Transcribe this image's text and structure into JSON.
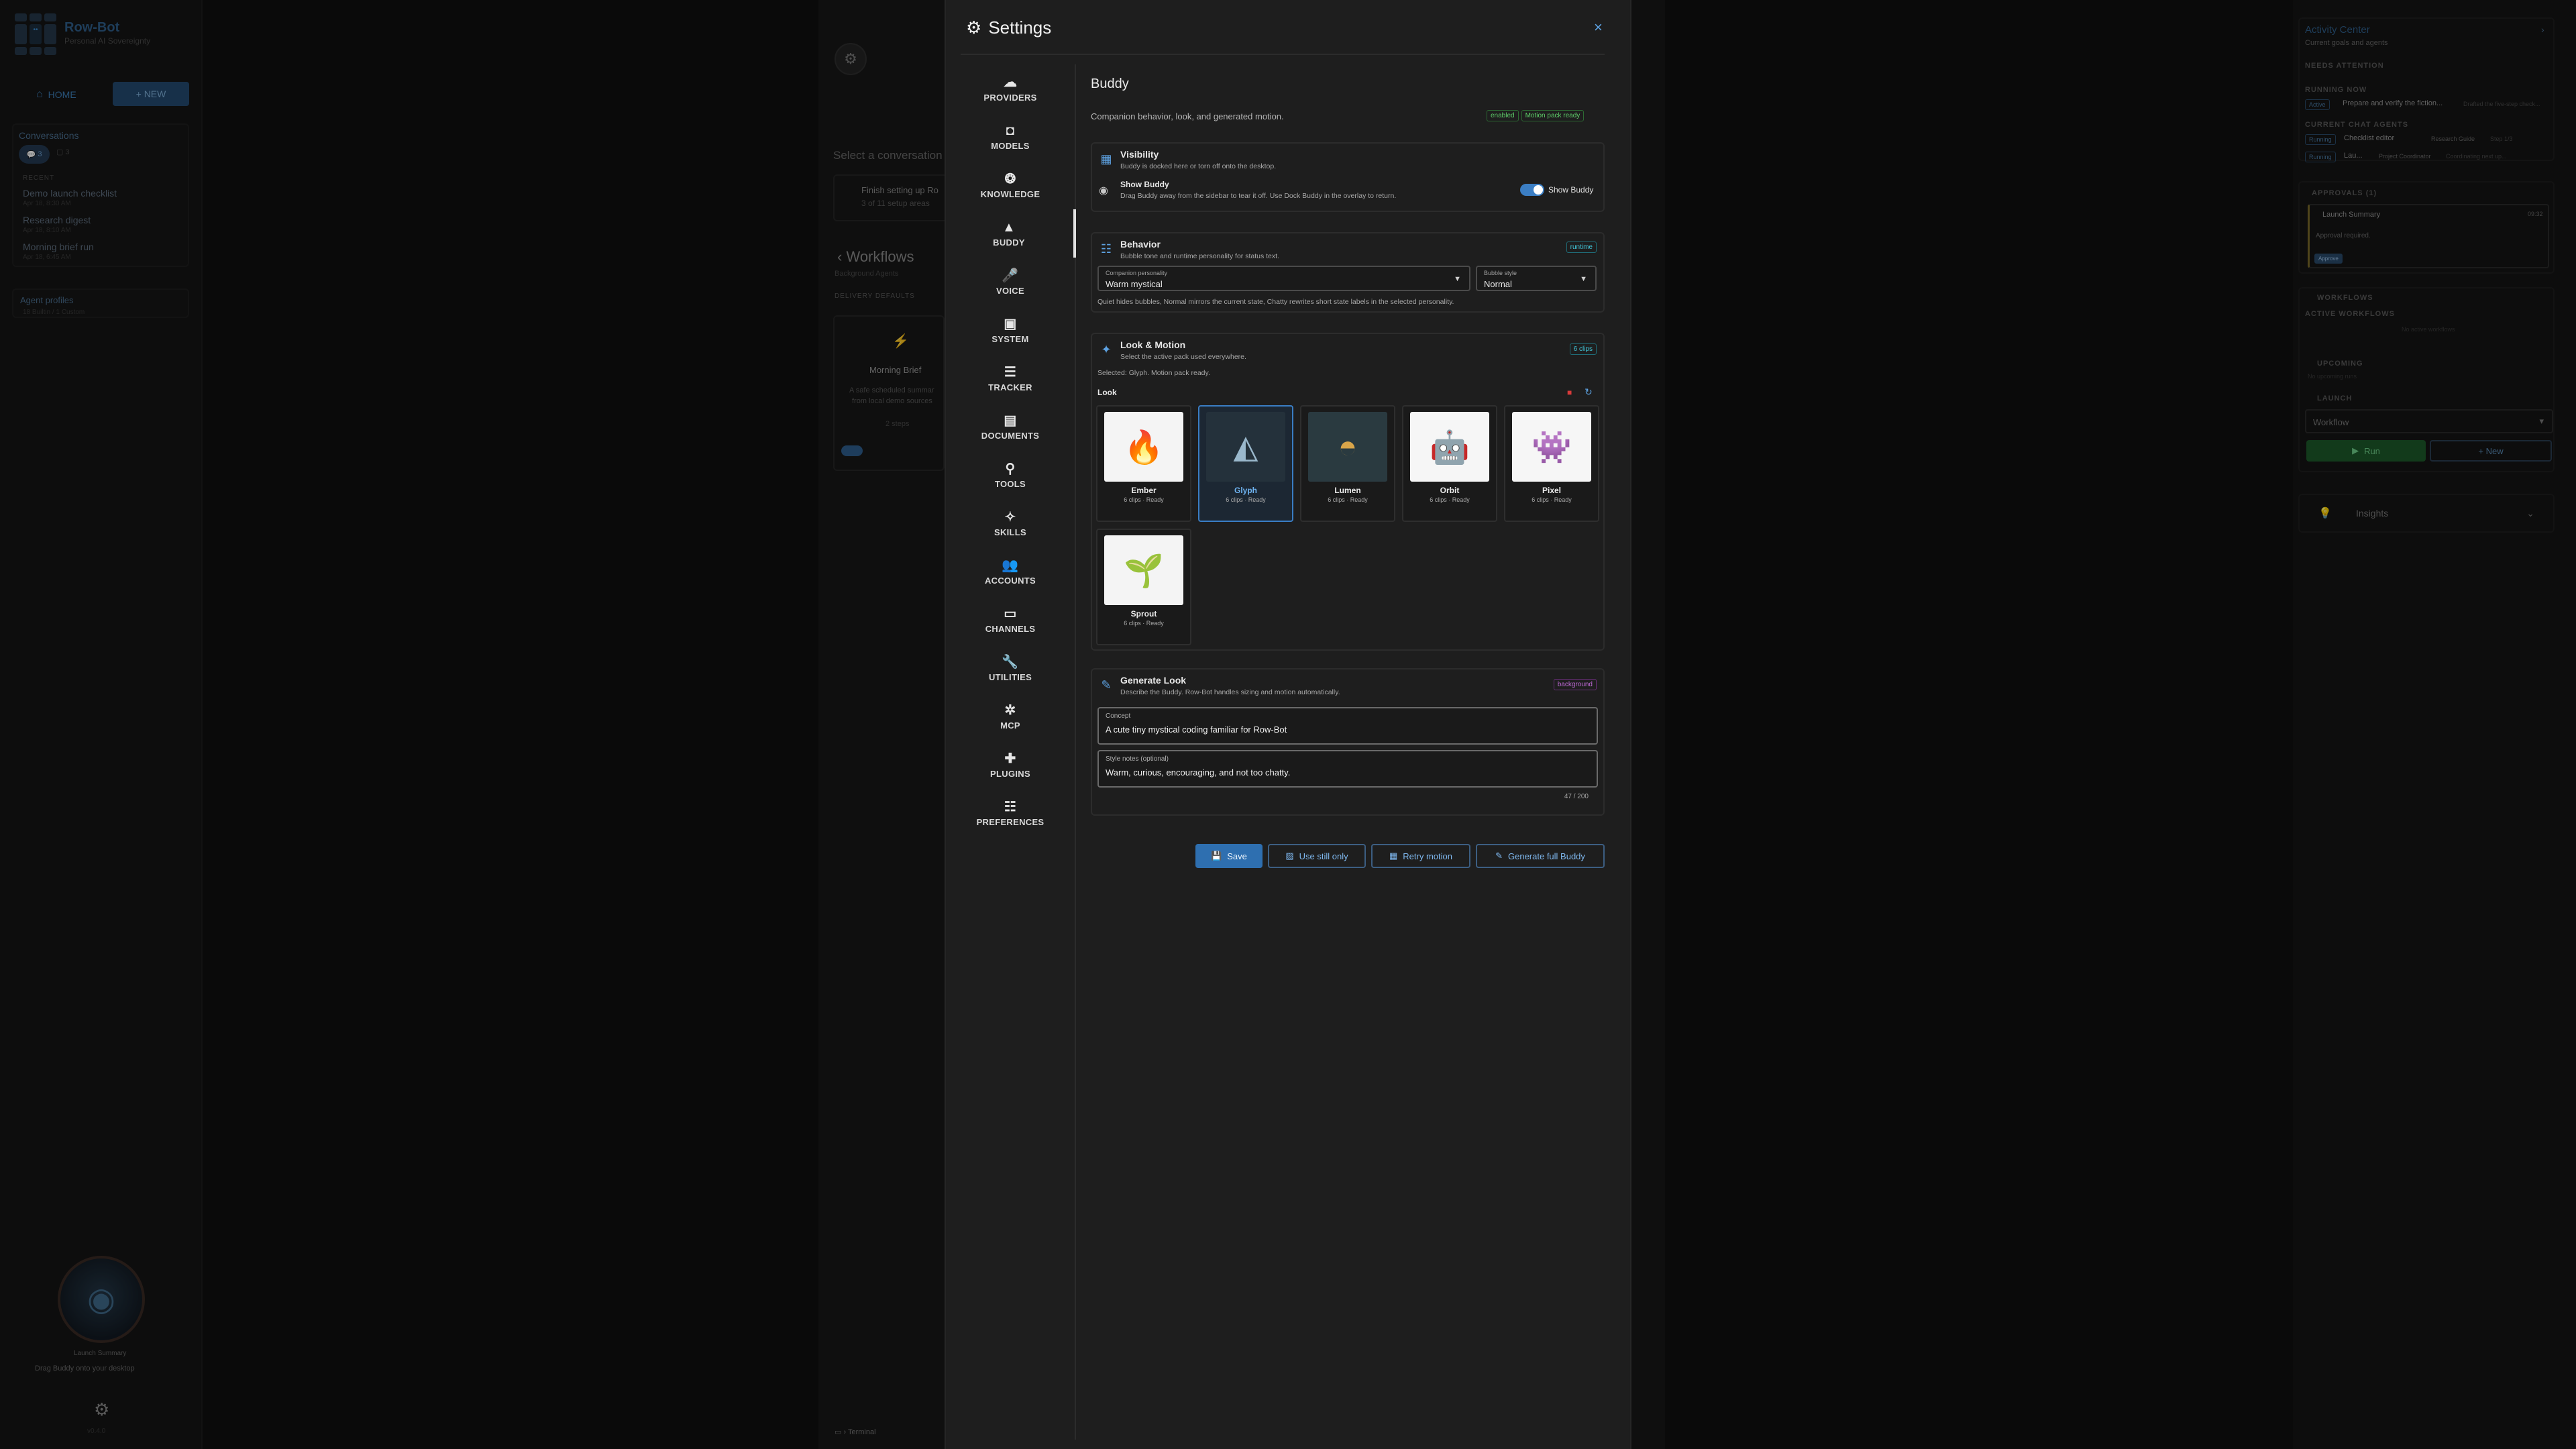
{
  "app": {
    "name": "Row-Bot",
    "tagline": "Personal AI Sovereignty",
    "home": "HOME",
    "new": "+ NEW",
    "conversations": "Conversations",
    "conv_count_a": "3",
    "conv_count_b": "3",
    "recent": "RECENT",
    "recent_items": [
      {
        "title": "Demo launch checklist",
        "sub": "Apr 18, 8:30 AM"
      },
      {
        "title": "Research digest",
        "sub": "Apr 18, 8:10 AM"
      },
      {
        "title": "Morning brief run",
        "sub": "Apr 18, 6:45 AM"
      }
    ],
    "agent_profiles": "Agent profiles",
    "agent_profiles_sub": "18 Builtin / 1 Custom",
    "launch_summary": "Launch Summary",
    "drag_buddy": "Drag Buddy onto your desktop",
    "version": "v0.4.0"
  },
  "middle": {
    "select_conv": "Select a conversation",
    "setup_title": "Finish setting up Ro",
    "setup_sub": "3 of 11 setup areas",
    "workflows": "Workflows",
    "bg_agents": "Background Agents",
    "delivery": "DELIVERY DEFAULTS",
    "morning_brief": "Morning Brief",
    "mb_desc1": "A safe scheduled summar",
    "mb_desc2": "from local demo sources",
    "mb_steps": "2 steps",
    "terminal": "Terminal"
  },
  "activity": {
    "title": "Activity Center",
    "sub": "Current goals and agents",
    "needs_attention": "NEEDS ATTENTION",
    "running_now": "RUNNING NOW",
    "running_badge": "Active",
    "running_text": "Prepare and verify the fiction...",
    "running_extra": "Drafted the five-step check...",
    "current_agents": "CURRENT CHAT AGENTS",
    "agents": [
      {
        "badge": "Running",
        "name": "Checklist editor",
        "role": "Research Guide",
        "time": "Step 1/3"
      },
      {
        "badge": "Running",
        "name": "Lau...",
        "role": "Project Coordinator",
        "time": "Coordinating next up..."
      }
    ],
    "approvals": "APPROVALS (1)",
    "approval_item": "Launch Summary",
    "approval_time": "09:32",
    "approval_req": "Approval required.",
    "approve": "Approve",
    "workflows": "WORKFLOWS",
    "active_workflows": "ACTIVE WORKFLOWS",
    "no_active": "No active workflows",
    "upcoming": "UPCOMING",
    "no_upcoming": "No upcoming runs",
    "launch": "LAUNCH",
    "workflow_select": "Workflow",
    "run": "Run",
    "new": "New",
    "insights": "Insights"
  },
  "settings": {
    "title": "Settings",
    "close": "×",
    "nav": [
      "PROVIDERS",
      "MODELS",
      "KNOWLEDGE",
      "BUDDY",
      "VOICE",
      "SYSTEM",
      "TRACKER",
      "DOCUMENTS",
      "TOOLS",
      "SKILLS",
      "ACCOUNTS",
      "CHANNELS",
      "UTILITIES",
      "MCP",
      "PLUGINS",
      "PREFERENCES"
    ],
    "page_title": "Buddy",
    "page_sub": "Companion behavior, look, and generated motion.",
    "tag_enabled": "enabled",
    "tag_motion": "Motion pack ready",
    "visibility": {
      "title": "Visibility",
      "sub": "Buddy is docked here or torn off onto the desktop.",
      "show_title": "Show Buddy",
      "show_sub": "Drag Buddy away from the sidebar to tear it off. Use Dock Buddy in the overlay to return.",
      "toggle_label": "Show Buddy"
    },
    "behavior": {
      "title": "Behavior",
      "sub": "Bubble tone and runtime personality for status text.",
      "tag": "runtime",
      "personality_label": "Companion personality",
      "personality_value": "Warm mystical",
      "bubble_label": "Bubble style",
      "bubble_value": "Normal",
      "hint": "Quiet hides bubbles, Normal mirrors the current state, Chatty rewrites short state labels in the selected personality."
    },
    "look": {
      "title": "Look & Motion",
      "sub": "Select the active pack used everywhere.",
      "tag": "6 clips",
      "selected": "Selected: Glyph. Motion pack ready.",
      "label": "Look",
      "packs": [
        {
          "name": "Ember",
          "status": "6 clips · Ready"
        },
        {
          "name": "Glyph",
          "status": "6 clips · Ready"
        },
        {
          "name": "Lumen",
          "status": "6 clips · Ready"
        },
        {
          "name": "Orbit",
          "status": "6 clips · Ready"
        },
        {
          "name": "Pixel",
          "status": "6 clips · Ready"
        },
        {
          "name": "Sprout",
          "status": "6 clips · Ready"
        }
      ]
    },
    "generate": {
      "title": "Generate Look",
      "sub": "Describe the Buddy. Row-Bot handles sizing and motion automatically.",
      "tag": "background",
      "concept_label": "Concept",
      "concept_value": "A cute tiny mystical coding familiar for Row-Bot",
      "style_label": "Style notes (optional)",
      "style_value": "Warm, curious, encouraging, and not too chatty.",
      "count": "47 / 200"
    },
    "actions": {
      "save": "Save",
      "still": "Use still only",
      "retry": "Retry motion",
      "full": "Generate full Buddy"
    }
  },
  "colors": {
    "accent": "#3b7ec4",
    "enabled": "#5fcf6a",
    "clips": "#41c5d8",
    "background_tag": "#c06ad8",
    "run": "#1d5a2a"
  }
}
